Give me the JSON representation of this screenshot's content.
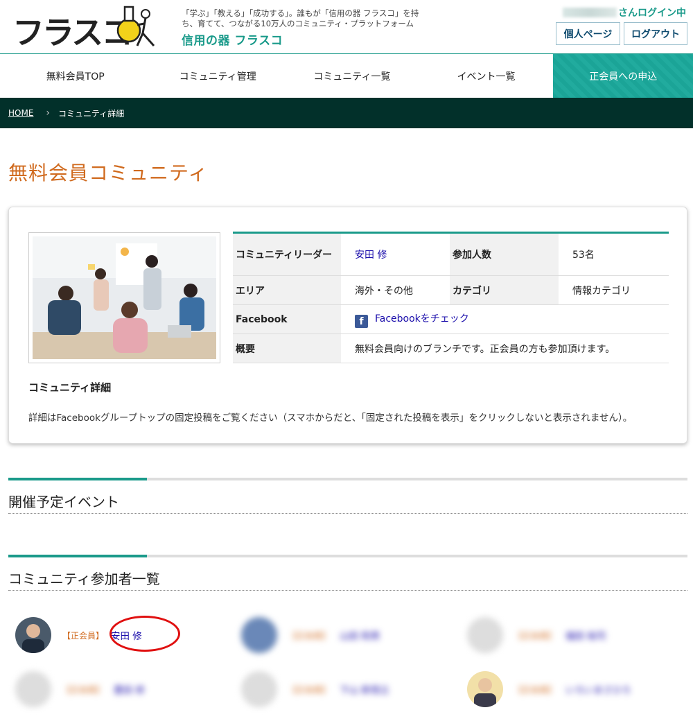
{
  "header": {
    "logo_text": "フラスコ",
    "tagline": "「学ぶ」「教える」「成功する」。誰もが「信用の器 フラスコ」を持ち、育てて、つながる10万人のコミュニティ・プラットフォーム",
    "site_name": "信用の器 フラスコ",
    "login_status": "さんログイン中",
    "mypage_button": "個人ページ",
    "logout_button": "ログアウト"
  },
  "nav": {
    "items": [
      "無料会員TOP",
      "コミュニティ管理",
      "コミュニティ一覧",
      "イベント一覧"
    ],
    "cta": "正会員への申込"
  },
  "breadcrumb": {
    "home": "HOME",
    "current": "コミュニティ詳細"
  },
  "page_title": "無料会員コミュニティ",
  "community": {
    "leader_label": "コミュニティリーダー",
    "leader": "安田 修",
    "members_label": "参加人数",
    "members": "53名",
    "area_label": "エリア",
    "area": "海外・その他",
    "category_label": "カテゴリ",
    "category": "情報カテゴリ",
    "facebook_label": "Facebook",
    "facebook_link": "Facebookをチェック",
    "summary_label": "概要",
    "summary": "無料会員向けのブランチです。正会員の方も参加頂けます。",
    "detail_title": "コミュニティ詳細",
    "detail_text": "詳細はFacebookグループトップの固定投稿をご覧ください（スマホからだと、「固定された投稿を表示」をクリックしないと表示されません）。"
  },
  "sections": {
    "events": "開催予定イベント",
    "members": "コミュニティ参加者一覧"
  },
  "member_list": [
    {
      "role": "【正会員】",
      "name": "安田 修"
    },
    {
      "role": "【正会員】",
      "name": "山田 和男"
    },
    {
      "role": "【正会員】",
      "name": "福田 裕司"
    },
    {
      "role": "【正会員】",
      "name": "豊田 修"
    },
    {
      "role": "【正会員】",
      "name": "下山 新悟立"
    },
    {
      "role": "【正会員】",
      "name": "いろいまさひろ"
    }
  ],
  "colors": {
    "accent": "#1a9a8a",
    "title_orange": "#d06a1e",
    "breadcrumb_bg": "#02302a",
    "highlight_circle": "#e01010"
  }
}
